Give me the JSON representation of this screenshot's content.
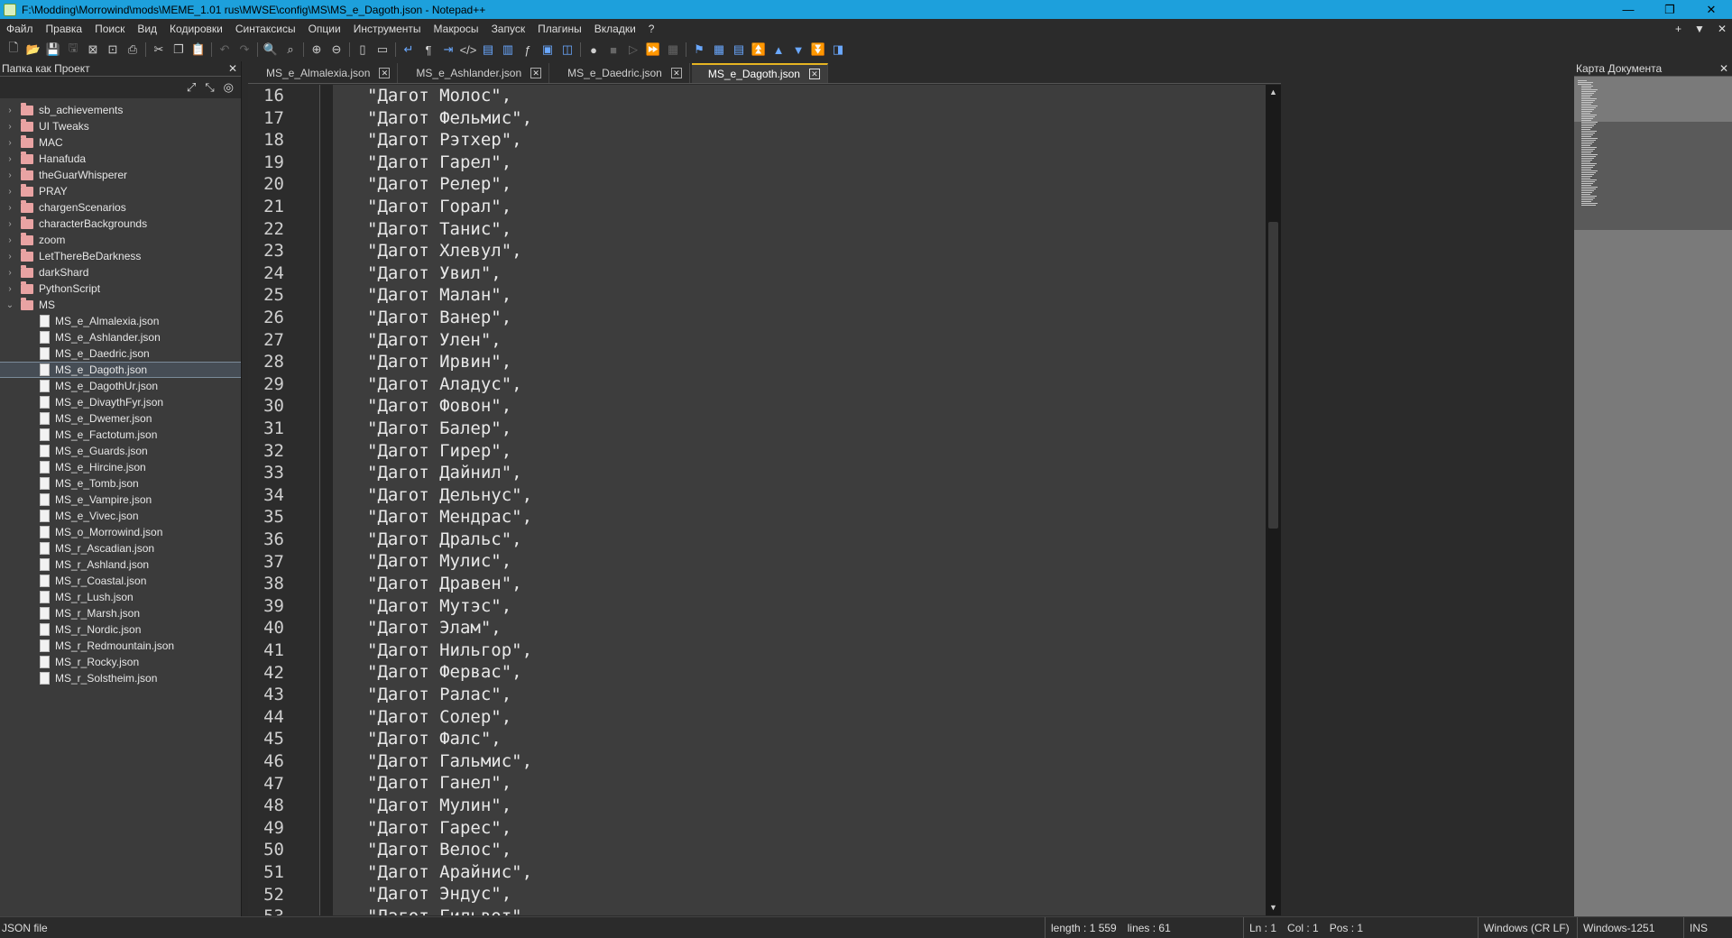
{
  "window": {
    "title": "F:\\Modding\\Morrowind\\mods\\MEME_1.01 rus\\MWSE\\config\\MS\\MS_e_Dagoth.json - Notepad++",
    "controls": [
      "—",
      "❐",
      "✕"
    ]
  },
  "menu": {
    "items": [
      "Файл",
      "Правка",
      "Поиск",
      "Вид",
      "Кодировки",
      "Синтаксисы",
      "Опции",
      "Инструменты",
      "Макросы",
      "Запуск",
      "Плагины",
      "Вкладки",
      "?"
    ],
    "right": [
      "+",
      "▼",
      "✕"
    ]
  },
  "toolbar": {
    "icons": [
      "new-file-icon",
      "open-file-icon",
      "save-icon",
      "save-all-icon",
      "close-icon",
      "close-all-icon",
      "print-icon",
      "cut-icon",
      "copy-icon",
      "paste-icon",
      "undo-icon",
      "redo-icon",
      "find-icon",
      "replace-icon",
      "zoom-in-icon",
      "zoom-out-icon",
      "sync-vertical-icon",
      "sync-horizontal-icon",
      "word-wrap-icon",
      "show-all-chars-icon",
      "indent-guide-icon",
      "html-tag-icon",
      "doc-map-icon",
      "doc-list-icon",
      "function-list-icon",
      "folder-workspace-icon",
      "monitor-icon",
      "record-macro-icon",
      "stop-macro-icon",
      "play-macro-icon",
      "run-multiple-icon",
      "save-macro-icon",
      "bookmark-icon",
      "compare-icon",
      "compare-next-icon",
      "first-diff-icon",
      "prev-diff-icon",
      "next-diff-icon",
      "last-diff-icon",
      "panel-icon"
    ]
  },
  "left_panel": {
    "title": "Папка как Проект",
    "close": "✕",
    "tools": [
      "⤢",
      "⤡",
      "◎"
    ],
    "folders": [
      {
        "name": "sb_achievements",
        "expanded": false
      },
      {
        "name": "UI Tweaks",
        "expanded": false
      },
      {
        "name": "MAC",
        "expanded": false
      },
      {
        "name": "Hanafuda",
        "expanded": false
      },
      {
        "name": "theGuarWhisperer",
        "expanded": false
      },
      {
        "name": "PRAY",
        "expanded": false
      },
      {
        "name": "chargenScenarios",
        "expanded": false
      },
      {
        "name": "characterBackgrounds",
        "expanded": false
      },
      {
        "name": "zoom",
        "expanded": false
      },
      {
        "name": "LetThereBeDarkness",
        "expanded": false
      },
      {
        "name": "darkShard",
        "expanded": false
      },
      {
        "name": "PythonScript",
        "expanded": false
      },
      {
        "name": "MS",
        "expanded": true
      }
    ],
    "files": [
      "MS_e_Almalexia.json",
      "MS_e_Ashlander.json",
      "MS_e_Daedric.json",
      "MS_e_Dagoth.json",
      "MS_e_DagothUr.json",
      "MS_e_DivaythFyr.json",
      "MS_e_Dwemer.json",
      "MS_e_Factotum.json",
      "MS_e_Guards.json",
      "MS_e_Hircine.json",
      "MS_e_Tomb.json",
      "MS_e_Vampire.json",
      "MS_e_Vivec.json",
      "MS_o_Morrowind.json",
      "MS_r_Ascadian.json",
      "MS_r_Ashland.json",
      "MS_r_Coastal.json",
      "MS_r_Lush.json",
      "MS_r_Marsh.json",
      "MS_r_Nordic.json",
      "MS_r_Redmountain.json",
      "MS_r_Rocky.json",
      "MS_r_Solstheim.json"
    ],
    "selected_file": "MS_e_Dagoth.json"
  },
  "tabs": [
    {
      "label": "MS_e_Almalexia.json",
      "active": false
    },
    {
      "label": "MS_e_Ashlander.json",
      "active": false
    },
    {
      "label": "MS_e_Daedric.json",
      "active": false
    },
    {
      "label": "MS_e_Dagoth.json",
      "active": true
    }
  ],
  "editor": {
    "first_line": 16,
    "lines": [
      "\"Дагот Молос\",",
      "\"Дагот Фельмис\",",
      "\"Дагот Рэтхер\",",
      "\"Дагот Гарел\",",
      "\"Дагот Релер\",",
      "\"Дагот Горал\",",
      "\"Дагот Танис\",",
      "\"Дагот Хлевул\",",
      "\"Дагот Увил\",",
      "\"Дагот Малан\",",
      "\"Дагот Ванер\",",
      "\"Дагот Улен\",",
      "\"Дагот Ирвин\",",
      "\"Дагот Аладус\",",
      "\"Дагот Фовон\",",
      "\"Дагот Балер\",",
      "\"Дагот Гирер\",",
      "\"Дагот Дайнил\",",
      "\"Дагот Дельнус\",",
      "\"Дагот Мендрас\",",
      "\"Дагот Дральс\",",
      "\"Дагот Мулис\",",
      "\"Дагот Дравен\",",
      "\"Дагот Мутэс\",",
      "\"Дагот Элам\",",
      "\"Дагот Нильгор\",",
      "\"Дагот Фервас\",",
      "\"Дагот Ралас\",",
      "\"Дагот Солер\",",
      "\"Дагот Фалс\",",
      "\"Дагот Гальмис\",",
      "\"Дагот Ганел\",",
      "\"Дагот Мулин\",",
      "\"Дагот Гарес\",",
      "\"Дагот Велос\",",
      "\"Дагот Арайнис\",",
      "\"Дагот Эндус\",",
      "\"Дагот Гильвот\","
    ]
  },
  "right_panel": {
    "title": "Карта Документа",
    "close": "✕"
  },
  "statusbar": {
    "file_type": "JSON file",
    "length": "length : 1 559",
    "lines": "lines : 61",
    "ln": "Ln : 1",
    "col": "Col : 1",
    "pos": "Pos : 1",
    "eol": "Windows (CR LF)",
    "encoding": "Windows-1251",
    "mode": "INS"
  }
}
